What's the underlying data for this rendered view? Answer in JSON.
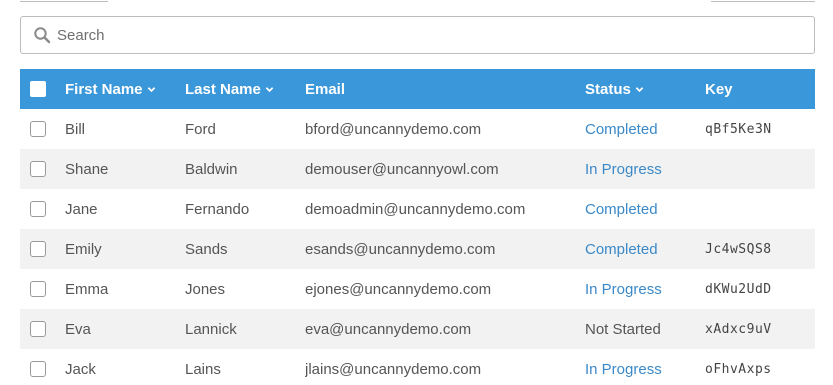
{
  "search": {
    "placeholder": "Search",
    "value": ""
  },
  "table": {
    "headers": {
      "first_name": "First Name",
      "last_name": "Last Name",
      "email": "Email",
      "status": "Status",
      "key": "Key"
    },
    "rows": [
      {
        "first": "Bill",
        "last": "Ford",
        "email": "bford@uncannydemo.com",
        "status": "Completed",
        "key": "qBf5Ke3N"
      },
      {
        "first": "Shane",
        "last": "Baldwin",
        "email": "demouser@uncannyowl.com",
        "status": "In Progress",
        "key": ""
      },
      {
        "first": "Jane",
        "last": "Fernando",
        "email": "demoadmin@uncannydemo.com",
        "status": "Completed",
        "key": ""
      },
      {
        "first": "Emily",
        "last": "Sands",
        "email": "esands@uncannydemo.com",
        "status": "Completed",
        "key": "Jc4wSQS8"
      },
      {
        "first": "Emma",
        "last": "Jones",
        "email": "ejones@uncannydemo.com",
        "status": "In Progress",
        "key": "dKWu2UdD"
      },
      {
        "first": "Eva",
        "last": "Lannick",
        "email": "eva@uncannydemo.com",
        "status": "Not Started",
        "key": "xAdxc9uV"
      },
      {
        "first": "Jack",
        "last": "Lains",
        "email": "jlains@uncannydemo.com",
        "status": "In Progress",
        "key": "oFhvAxps"
      }
    ]
  },
  "colors": {
    "header_bg": "#3a97d9",
    "link": "#3a89c9",
    "row_alt": "#f2f2f2"
  },
  "icons": {
    "search": "search-icon",
    "sort": "chevron-down-icon",
    "checkbox": "checkbox-icon"
  }
}
